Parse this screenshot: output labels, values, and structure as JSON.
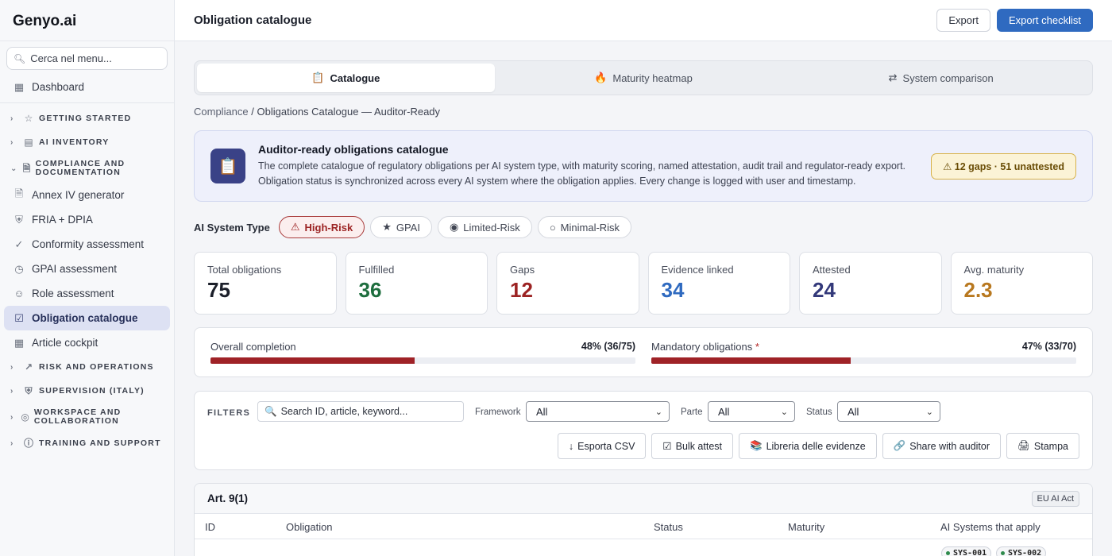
{
  "brand": "Genyo.ai",
  "sidebar": {
    "search_placeholder": "Cerca nel menu...",
    "dashboard": "Dashboard",
    "groups": {
      "getting_started": "GETTING STARTED",
      "ai_inventory": "AI INVENTORY",
      "compliance": "COMPLIANCE AND DOCUMENTATION",
      "risk": "RISK AND OPERATIONS",
      "supervision": "SUPERVISION (ITALY)",
      "workspace": "WORKSPACE AND COLLABORATION",
      "training": "TRAINING AND SUPPORT"
    },
    "items": [
      {
        "label": "Annex IV generator",
        "icon": "document-icon"
      },
      {
        "label": "FRIA + DPIA",
        "icon": "shield-icon"
      },
      {
        "label": "Conformity assessment",
        "icon": "check-circle-icon"
      },
      {
        "label": "GPAI assessment",
        "icon": "clock-icon"
      },
      {
        "label": "Role assessment",
        "icon": "user-icon"
      },
      {
        "label": "Obligation catalogue",
        "icon": "checklist-icon",
        "active": true
      },
      {
        "label": "Article cockpit",
        "icon": "grid-icon"
      }
    ]
  },
  "header": {
    "title": "Obligation catalogue",
    "export_label": "Export",
    "export_checklist_label": "Export checklist"
  },
  "tabs": [
    {
      "label": "Catalogue",
      "icon": "📋"
    },
    {
      "label": "Maturity heatmap",
      "icon": "🔥"
    },
    {
      "label": "System comparison",
      "icon": "⇄"
    }
  ],
  "breadcrumb": {
    "root": "Compliance",
    "current": "Obligations Catalogue — Auditor-Ready"
  },
  "banner": {
    "icon": "📋",
    "title": "Auditor-ready obligations catalogue",
    "description": "The complete catalogue of regulatory obligations per AI system type, with maturity scoring, named attestation, audit trail and regulator-ready export. Obligation status is synchronized across every AI system where the obligation applies. Every change is logged with user and timestamp.",
    "badge": "⚠ 12 gaps · 51 unattested"
  },
  "system_type": {
    "label": "AI System Type",
    "options": [
      {
        "label": "High-Risk",
        "icon": "⚠"
      },
      {
        "label": "GPAI",
        "icon": "★"
      },
      {
        "label": "Limited-Risk",
        "icon": "◉"
      },
      {
        "label": "Minimal-Risk",
        "icon": "○"
      }
    ]
  },
  "stats": [
    {
      "label": "Total obligations",
      "value": "75",
      "color": "#1b1f2a"
    },
    {
      "label": "Fulfilled",
      "value": "36",
      "color": "#1e6e3e"
    },
    {
      "label": "Gaps",
      "value": "12",
      "color": "#9c2323"
    },
    {
      "label": "Evidence linked",
      "value": "34",
      "color": "#2f6ac0"
    },
    {
      "label": "Attested",
      "value": "24",
      "color": "#33397a"
    },
    {
      "label": "Avg. maturity",
      "value": "2.3",
      "color": "#b8781f"
    }
  ],
  "progress": [
    {
      "label": "Overall completion",
      "pct_text": "48% (36/75)",
      "fraction": 0.48,
      "required": false
    },
    {
      "label": "Mandatory obligations",
      "pct_text": "47% (33/70)",
      "fraction": 0.47,
      "required": true
    }
  ],
  "filters": {
    "label": "FILTERS",
    "search_placeholder": "Search ID, article, keyword...",
    "framework_label": "Framework",
    "framework_value": "All",
    "parte_label": "Parte",
    "parte_value": "All",
    "status_label": "Status",
    "status_value": "All",
    "actions": [
      {
        "label": "Esporta CSV",
        "icon": "↓"
      },
      {
        "label": "Bulk attest",
        "icon": "☑"
      },
      {
        "label": "Libreria delle evidenze",
        "icon": "📚"
      },
      {
        "label": "Share with auditor",
        "icon": "🔗"
      },
      {
        "label": "Stampa",
        "icon": "🖨"
      }
    ]
  },
  "table": {
    "title": "Art. 9(1)",
    "framework_tag": "EU AI Act",
    "columns": [
      "ID",
      "Obligation",
      "Status",
      "Maturity",
      "AI Systems that apply"
    ],
    "systems": [
      "SYS-001",
      "SYS-002"
    ]
  }
}
